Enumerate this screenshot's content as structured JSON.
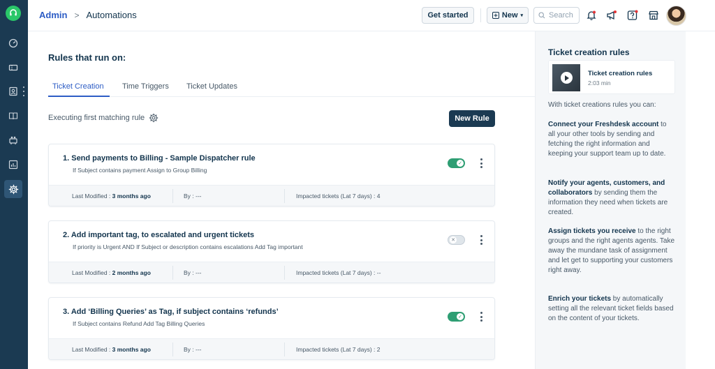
{
  "sidebar": {
    "items": [
      {
        "name": "dashboard",
        "active": false
      },
      {
        "name": "tickets",
        "active": false
      },
      {
        "name": "contacts",
        "active": false
      },
      {
        "name": "solutions",
        "active": false
      },
      {
        "name": "groups",
        "active": false
      },
      {
        "name": "reports",
        "active": false
      },
      {
        "name": "admin",
        "active": true
      }
    ]
  },
  "header": {
    "breadcrumb_root": "Admin",
    "breadcrumb_separator": ">",
    "breadcrumb_current": "Automations",
    "get_started_label": "Get started",
    "new_label": "New",
    "search_placeholder": "Search"
  },
  "main": {
    "title": "Rules that run on:",
    "tabs": [
      "Ticket Creation",
      "Time Triggers",
      "Ticket Updates"
    ],
    "active_tab": "Ticket Creation",
    "executing_label": "Executing first matching rule",
    "new_rule_label": "New Rule",
    "rules": [
      {
        "title": "1. Send payments to Billing - Sample Dispatcher rule",
        "description": "If Subject contains payment Assign to Group Billing",
        "enabled": true,
        "last_modified_label": "Last Modified : ",
        "last_modified": "3 months ago",
        "by_label": "By : ",
        "by": "---",
        "impacted_label": "Impacted tickets (Lat 7 days) : ",
        "impacted": "4"
      },
      {
        "title": "2. Add important tag, to escalated and urgent tickets",
        "description": "If priority is Urgent AND If Subject or description contains escalations Add Tag important",
        "enabled": false,
        "last_modified_label": "Last Modified : ",
        "last_modified": "2 months ago",
        "by_label": "By : ",
        "by": "---",
        "impacted_label": "Impacted tickets (Lat 7 days) : ",
        "impacted": "--"
      },
      {
        "title": "3. Add ‘Billing Queries’ as Tag, if subject contains ‘refunds’",
        "description": "If Subject contains Refund Add Tag Billing Queries",
        "enabled": true,
        "last_modified_label": "Last Modified : ",
        "last_modified": "3 months ago",
        "by_label": "By : ",
        "by": "---",
        "impacted_label": "Impacted tickets (Lat 7 days) : ",
        "impacted": "2"
      }
    ]
  },
  "panel": {
    "title": "Ticket creation rules",
    "video_title": "Ticket creation rules",
    "video_duration": "2:03 min",
    "intro": "With ticket creations rules you can:",
    "paragraphs": [
      {
        "bold": "Connect your Freshdesk account",
        "text": " to all your other tools by sending and fetching the right information and keeping your support team up to date."
      },
      {
        "bold": "Notify your agents, customers, and collaborators",
        "text": " by sending them the information they need when tickets are created."
      },
      {
        "bold": "Assign tickets you receive",
        "text": " to the right groups and the right agents agents. Take away the mundane task of assignment and let get to supporting your customers right away."
      },
      {
        "bold": "Enrich your tickets",
        "text": " by automatically setting all the relevant ticket fields based on the content of your tickets."
      }
    ]
  },
  "colors": {
    "sidebar": "#1b3a52",
    "accent": "#2c5cc5",
    "toggle_on": "#2e9e73",
    "brand_logo": "#2ac769"
  }
}
